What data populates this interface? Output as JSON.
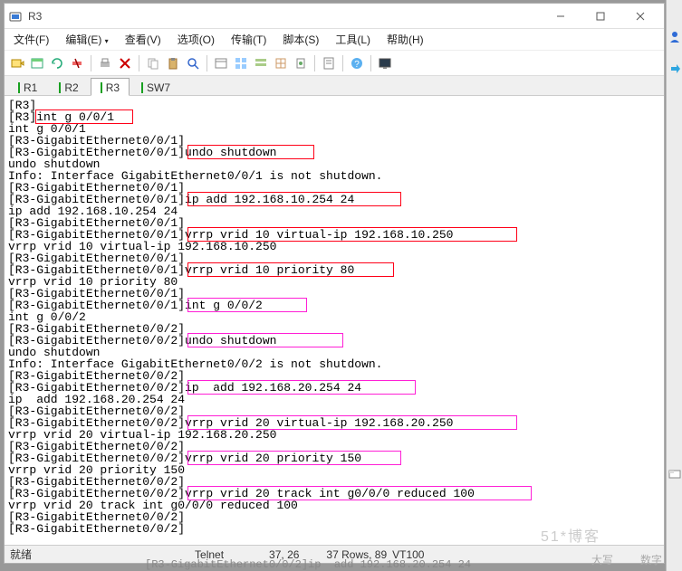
{
  "window": {
    "title": "R3"
  },
  "menu": {
    "file": "文件(F)",
    "edit": "编辑(E)",
    "view": "查看(V)",
    "options": "选项(O)",
    "transfer": "传输(T)",
    "script": "脚本(S)",
    "tools": "工具(L)",
    "help": "帮助(H)"
  },
  "tabs": {
    "t1": "R1",
    "t2": "R2",
    "t3": "R3",
    "t4": "SW7"
  },
  "terminal": {
    "lines": [
      "[R3]",
      "[R3]int g 0/0/1",
      "int g 0/0/1",
      "[R3-GigabitEthernet0/0/1]",
      "[R3-GigabitEthernet0/0/1]undo shutdown",
      "undo shutdown",
      "Info: Interface GigabitEthernet0/0/1 is not shutdown.",
      "[R3-GigabitEthernet0/0/1]",
      "[R3-GigabitEthernet0/0/1]ip add 192.168.10.254 24",
      "ip add 192.168.10.254 24",
      "[R3-GigabitEthernet0/0/1]",
      "[R3-GigabitEthernet0/0/1]vrrp vrid 10 virtual-ip 192.168.10.250",
      "vrrp vrid 10 virtual-ip 192.168.10.250",
      "[R3-GigabitEthernet0/0/1]",
      "[R3-GigabitEthernet0/0/1]vrrp vrid 10 priority 80",
      "vrrp vrid 10 priority 80",
      "[R3-GigabitEthernet0/0/1]",
      "[R3-GigabitEthernet0/0/1]int g 0/0/2",
      "int g 0/0/2",
      "[R3-GigabitEthernet0/0/2]",
      "[R3-GigabitEthernet0/0/2]undo shutdown",
      "undo shutdown",
      "Info: Interface GigabitEthernet0/0/2 is not shutdown.",
      "[R3-GigabitEthernet0/0/2]",
      "[R3-GigabitEthernet0/0/2]ip  add 192.168.20.254 24",
      "ip  add 192.168.20.254 24",
      "[R3-GigabitEthernet0/0/2]",
      "[R3-GigabitEthernet0/0/2]vrrp vrid 20 virtual-ip 192.168.20.250",
      "vrrp vrid 20 virtual-ip 192.168.20.250",
      "[R3-GigabitEthernet0/0/2]",
      "[R3-GigabitEthernet0/0/2]vrrp vrid 20 priority 150",
      "vrrp vrid 20 priority 150",
      "[R3-GigabitEthernet0/0/2]",
      "[R3-GigabitEthernet0/0/2]vrrp vrid 20 track int g0/0/0 reduced 100",
      "vrrp vrid 20 track int g0/0/0 reduced 100",
      "[R3-GigabitEthernet0/0/2]",
      "[R3-GigabitEthernet0/0/2]"
    ]
  },
  "highlights": [
    {
      "row": 1,
      "colStart": 4,
      "colEnd": 17,
      "cls": "red"
    },
    {
      "row": 4,
      "colStart": 25,
      "colEnd": 42,
      "cls": "red"
    },
    {
      "row": 8,
      "colStart": 25,
      "colEnd": 54,
      "cls": "red"
    },
    {
      "row": 11,
      "colStart": 25,
      "colEnd": 70,
      "cls": "red"
    },
    {
      "row": 14,
      "colStart": 25,
      "colEnd": 53,
      "cls": "red"
    },
    {
      "row": 17,
      "colStart": 25,
      "colEnd": 41,
      "cls": "mag"
    },
    {
      "row": 20,
      "colStart": 25,
      "colEnd": 46,
      "cls": "mag"
    },
    {
      "row": 24,
      "colStart": 25,
      "colEnd": 56,
      "cls": "mag"
    },
    {
      "row": 27,
      "colStart": 25,
      "colEnd": 70,
      "cls": "mag"
    },
    {
      "row": 30,
      "colStart": 25,
      "colEnd": 54,
      "cls": "mag"
    },
    {
      "row": 33,
      "colStart": 25,
      "colEnd": 72,
      "cls": "mag"
    }
  ],
  "status": {
    "ready": "就绪",
    "proto": "Telnet",
    "pos": "37, 26",
    "rows": "37 Rows, 89",
    "term": "VT100",
    "caps": "大写",
    "num": "数字"
  },
  "bottom_peek": "[R3-GigabitEthernet0/0/2]ip  add 192.168.20.254 24"
}
